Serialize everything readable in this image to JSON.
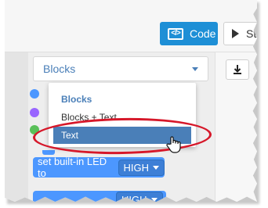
{
  "toolbar": {
    "code_label": "Code",
    "code_icon": "code-brackets-icon",
    "st_label": "St",
    "play_icon": "play-icon"
  },
  "editor_mode_select": {
    "selected": "Blocks",
    "caret_icon": "chevron-down-icon"
  },
  "dropdown": {
    "options": [
      "Blocks",
      "Blocks + Text",
      "Text"
    ],
    "current": "Blocks",
    "highlighted": "Text"
  },
  "download_icon": "download-icon",
  "blocks": {
    "set_led_label": "set built-in LED to",
    "set_led_value": "HIGH",
    "partial_block_value": "HIGH"
  },
  "category_dots": {
    "colors": [
      "#4c97ff",
      "#9966ff",
      "#59c059"
    ]
  },
  "colors": {
    "accent": "#1e8fd6",
    "select_text": "#4a7fb8",
    "highlight": "#4a7fb8",
    "block": "#4c97ff",
    "annotation": "#d6182a"
  }
}
